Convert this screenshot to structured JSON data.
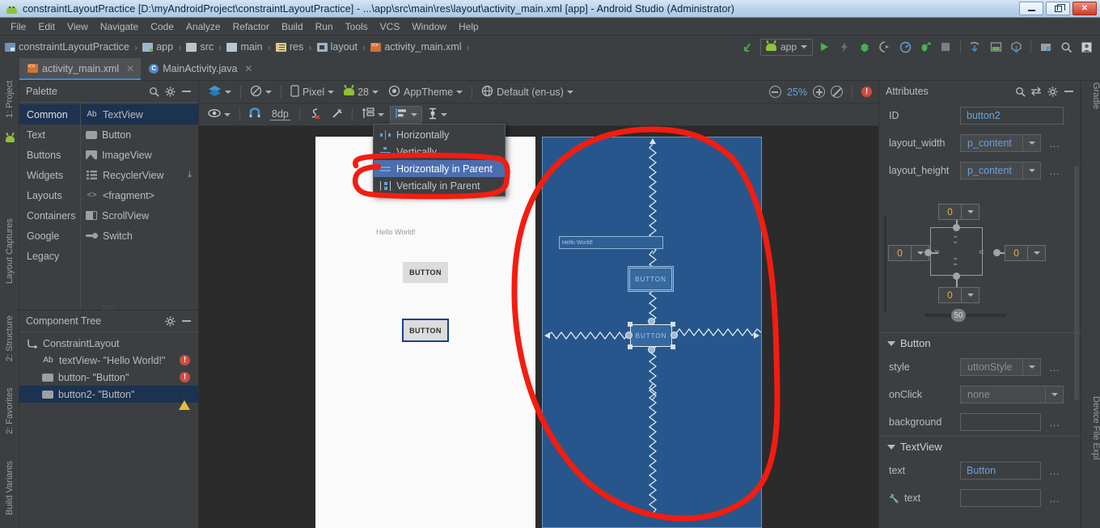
{
  "window": {
    "title": "constraintLayoutPractice [D:\\myAndroidProject\\constraintLayoutPractice] - ...\\app\\src\\main\\res\\layout\\activity_main.xml [app] - Android Studio (Administrator)",
    "app_icon": "android-logo-icon",
    "buttons": {
      "minimize": "minimize-icon",
      "maximize": "restore-icon",
      "close": "✕"
    }
  },
  "menubar": {
    "items": [
      "File",
      "Edit",
      "View",
      "Navigate",
      "Code",
      "Analyze",
      "Refactor",
      "Build",
      "Run",
      "Tools",
      "VCS",
      "Window",
      "Help"
    ]
  },
  "breadcrumb": {
    "separator": "›",
    "items": [
      {
        "label": "constraintLayoutPractice",
        "icon": "project-icon"
      },
      {
        "label": "app",
        "icon": "module-icon"
      },
      {
        "label": "src",
        "icon": "folder-icon"
      },
      {
        "label": "main",
        "icon": "folder-icon"
      },
      {
        "label": "res",
        "icon": "res-folder-icon"
      },
      {
        "label": "layout",
        "icon": "layout-folder-icon"
      },
      {
        "label": "activity_main.xml",
        "icon": "xml-file-icon"
      }
    ]
  },
  "navtools": {
    "back_icon": "back-arrow-icon",
    "run_config": "app",
    "icons": [
      "run-icon",
      "apply-changes-icon",
      "debug-icon",
      "attach-debugger-icon",
      "profiler-icon",
      "run-coverage-icon",
      "stop-icon",
      "sync-gradle-icon",
      "avd-manager-icon",
      "sdk-manager-icon",
      "project-structure-icon",
      "search-icon",
      "user-icon"
    ]
  },
  "editor_tabs": [
    {
      "label": "activity_main.xml",
      "icon": "xml-file-icon",
      "active": true,
      "close": "✕"
    },
    {
      "label": "MainActivity.java",
      "icon": "java-class-icon",
      "active": false,
      "close": "✕"
    }
  ],
  "left_strip": [
    "1: Project",
    "Layout Captures",
    "2: Structure",
    "2: Favorites",
    "Build Variants"
  ],
  "right_strip": [
    "Gradle",
    "Device File Expl"
  ],
  "palette": {
    "title": "Palette",
    "header_icons": [
      "search-icon",
      "gear-icon",
      "minimize-icon"
    ],
    "categories": [
      "Common",
      "Text",
      "Buttons",
      "Widgets",
      "Layouts",
      "Containers",
      "Google",
      "Legacy"
    ],
    "selected_category": "Common",
    "items": [
      {
        "label": "TextView",
        "icon": "ab-text-icon",
        "selected": true,
        "download": ""
      },
      {
        "label": "Button",
        "icon": "button-icon",
        "selected": false,
        "download": ""
      },
      {
        "label": "ImageView",
        "icon": "image-icon",
        "selected": false,
        "download": ""
      },
      {
        "label": "RecyclerView",
        "icon": "list-icon",
        "selected": false,
        "download": "⤓"
      },
      {
        "label": "<fragment>",
        "icon": "code-brackets-icon",
        "selected": false,
        "download": ""
      },
      {
        "label": "ScrollView",
        "icon": "scrollview-icon",
        "selected": false,
        "download": ""
      },
      {
        "label": "Switch",
        "icon": "switch-icon",
        "selected": false,
        "download": ""
      }
    ]
  },
  "component_tree": {
    "title": "Component Tree",
    "header_icons": [
      "gear-icon",
      "minimize-icon"
    ],
    "rows": [
      {
        "label": "ConstraintLayout",
        "icon": "constraint-layout-icon",
        "indent": 0,
        "status": "",
        "selected": false
      },
      {
        "label": "textView- \"Hello World!\"",
        "icon": "ab-text-icon",
        "indent": 1,
        "status": "error",
        "selected": false
      },
      {
        "label": "button- \"Button\"",
        "icon": "button-icon",
        "indent": 1,
        "status": "error",
        "selected": false
      },
      {
        "label": "button2- \"Button\"",
        "icon": "button-icon",
        "indent": 1,
        "status": "warning",
        "selected": true
      }
    ]
  },
  "design_toolbar": {
    "row1": [
      {
        "label": "",
        "icon": "design-surface-icon",
        "caret": true
      },
      {
        "label": "",
        "icon": "orientation-icon",
        "caret": true
      },
      {
        "label": "Pixel",
        "icon": "device-icon",
        "caret": true
      },
      {
        "label": "28",
        "icon": "api-level-icon",
        "caret": true
      },
      {
        "label": "AppTheme",
        "icon": "theme-icon",
        "caret": true
      },
      {
        "label": "Default (en-us)",
        "icon": "locale-icon",
        "caret": true
      }
    ],
    "row2": [
      {
        "label": "",
        "icon": "eye-icon",
        "caret": true
      },
      {
        "label": "",
        "icon": "magnet-icon",
        "caret": false
      },
      {
        "label": "8dp",
        "icon": "margin-icon",
        "caret": false
      },
      {
        "label": "",
        "icon": "clear-constraints-icon",
        "caret": false
      },
      {
        "label": "",
        "icon": "infer-constraints-icon",
        "caret": false
      },
      {
        "label": "",
        "icon": "guidelines-icon",
        "caret": true
      },
      {
        "label": "",
        "icon": "align-icon",
        "caret": true,
        "active": true
      },
      {
        "label": "",
        "icon": "pack-icon",
        "caret": true
      }
    ],
    "zoom": {
      "out_icon": "zoom-out-icon",
      "level": "25%",
      "in_icon": "zoom-in-icon",
      "fit_icon": "zoom-fit-icon",
      "error_badge": "!"
    }
  },
  "align_menu": {
    "items": [
      {
        "label": "Horizontally",
        "icon": "align-horizontally-icon",
        "highlighted": false
      },
      {
        "label": "Vertically",
        "icon": "align-vertically-icon",
        "highlighted": false
      },
      {
        "label": "Horizontally in Parent",
        "icon": "center-horizontally-in-parent-icon",
        "highlighted": true
      },
      {
        "label": "Vertically in Parent",
        "icon": "center-vertically-in-parent-icon",
        "highlighted": false
      }
    ]
  },
  "canvas": {
    "design": {
      "textview": "Hello World!",
      "button1": "BUTTON",
      "button2": "BUTTON"
    },
    "blueprint": {
      "textview": "Hello World!",
      "button1": "BUTTON",
      "button2": "BUTTON"
    }
  },
  "attributes": {
    "title": "Attributes",
    "header_icons": [
      "search-icon",
      "sort-icon",
      "gear-icon",
      "minimize-icon"
    ],
    "id_label": "ID",
    "id_value": "button2",
    "layout_width_label": "layout_width",
    "layout_width_value": "p_content",
    "layout_height_label": "layout_height",
    "layout_height_value": "p_content",
    "constraint_widget": {
      "top": "0",
      "left": "0",
      "right": "0",
      "bottom": "0",
      "bias": "50"
    },
    "sections": [
      {
        "title": "Button",
        "rows": [
          {
            "label": "style",
            "value": "uttonStyle",
            "type": "combo",
            "dimmed": true,
            "dots": "…"
          },
          {
            "label": "onClick",
            "value": "none",
            "type": "combo",
            "dimmed": true,
            "dots": ""
          },
          {
            "label": "background",
            "value": "",
            "type": "field",
            "dimmed": false,
            "dots": "…"
          }
        ]
      },
      {
        "title": "TextView",
        "rows": [
          {
            "label": "text",
            "value": "Button",
            "type": "field",
            "dimmed": false,
            "dots": "…"
          },
          {
            "label": "text",
            "value": "",
            "type": "field",
            "dimmed": false,
            "dots": "…",
            "wrench": true
          }
        ]
      }
    ]
  },
  "annotation": {
    "color": "#f41c10",
    "shapes": [
      "ellipse-around-blueprint-canvas",
      "rounded-rect-around-parent-menu-items"
    ]
  }
}
